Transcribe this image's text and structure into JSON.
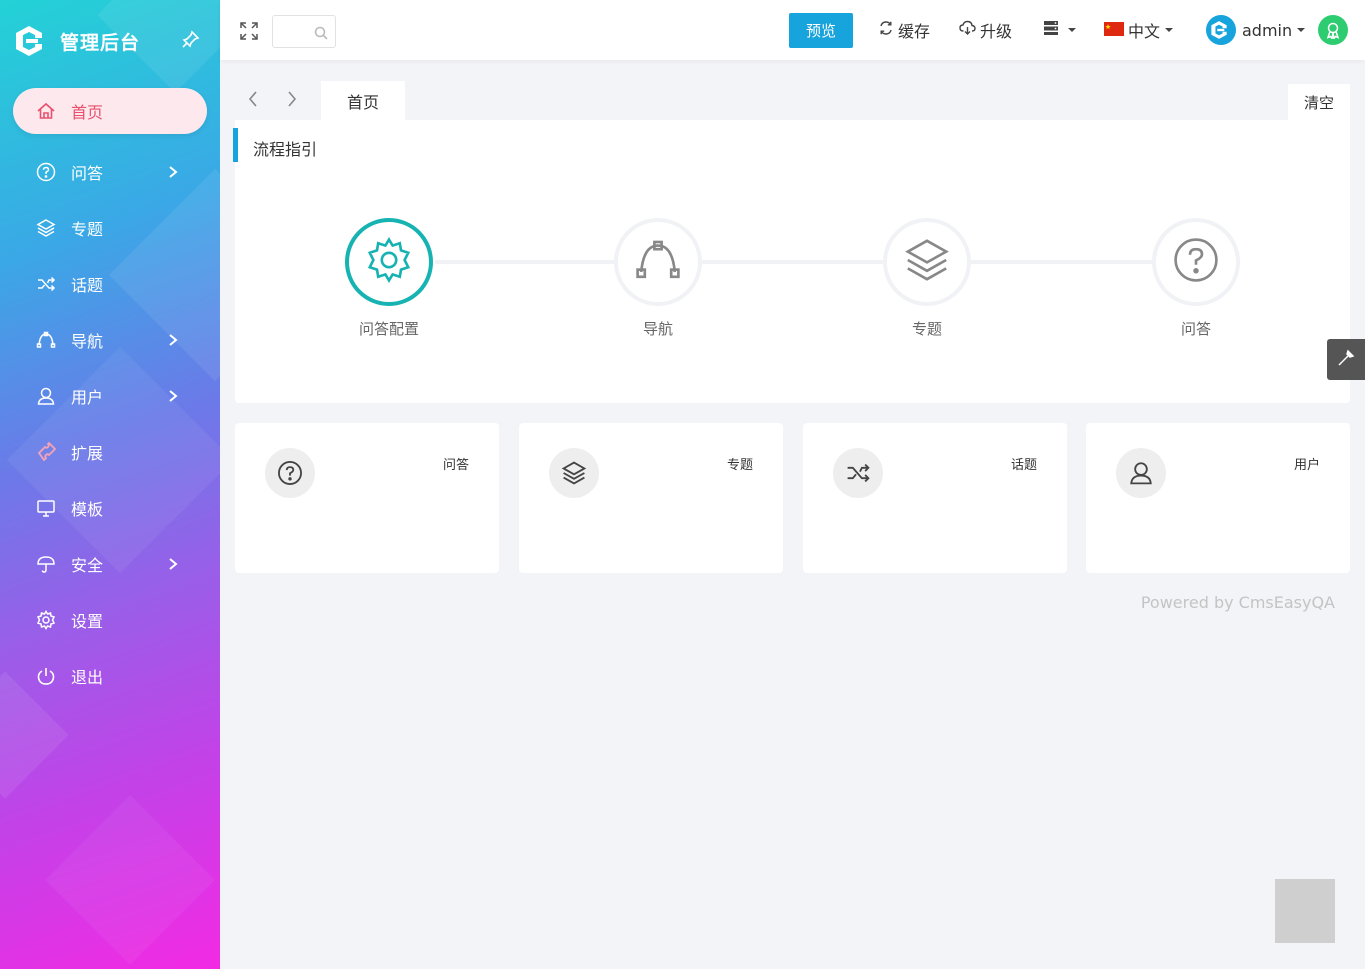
{
  "sidebar": {
    "title": "管理后台",
    "items": [
      {
        "label": "首页",
        "icon": "home-icon",
        "active": true,
        "has_children": false
      },
      {
        "label": "问答",
        "icon": "question-circle-icon",
        "has_children": true
      },
      {
        "label": "专题",
        "icon": "layers-icon",
        "has_children": false
      },
      {
        "label": "话题",
        "icon": "shuffle-icon",
        "has_children": false
      },
      {
        "label": "导航",
        "icon": "bezier-icon",
        "has_children": true
      },
      {
        "label": "用户",
        "icon": "user-icon",
        "has_children": true
      },
      {
        "label": "扩展",
        "icon": "puzzle-icon",
        "has_children": false
      },
      {
        "label": "模板",
        "icon": "monitor-icon",
        "has_children": false
      },
      {
        "label": "安全",
        "icon": "umbrella-icon",
        "has_children": true
      },
      {
        "label": "设置",
        "icon": "gear-icon",
        "has_children": false
      },
      {
        "label": "退出",
        "icon": "power-icon",
        "has_children": false
      }
    ]
  },
  "topbar": {
    "preview_label": "预览",
    "cache_label": "缓存",
    "upgrade_label": "升级",
    "language_label": "中文",
    "user_name": "admin"
  },
  "tabs": {
    "home_label": "首页",
    "clear_label": "清空"
  },
  "guide": {
    "title": "流程指引",
    "steps": [
      {
        "label": "问答配置",
        "icon": "gear-icon",
        "active": true
      },
      {
        "label": "导航",
        "icon": "bezier-icon",
        "active": false
      },
      {
        "label": "专题",
        "icon": "layers-icon",
        "active": false
      },
      {
        "label": "问答",
        "icon": "question-circle-icon",
        "active": false
      }
    ]
  },
  "cards": [
    {
      "label": "问答",
      "icon": "question-circle-icon"
    },
    {
      "label": "专题",
      "icon": "layers-icon"
    },
    {
      "label": "话题",
      "icon": "shuffle-icon"
    },
    {
      "label": "用户",
      "icon": "user-icon"
    }
  ],
  "footer": {
    "powered": "Powered by CmsEasyQA"
  },
  "colors": {
    "accent": "#17a3db",
    "teal": "#16b3b2",
    "active_menu_text": "#e9506d",
    "active_menu_bg": "#fde8ee"
  }
}
